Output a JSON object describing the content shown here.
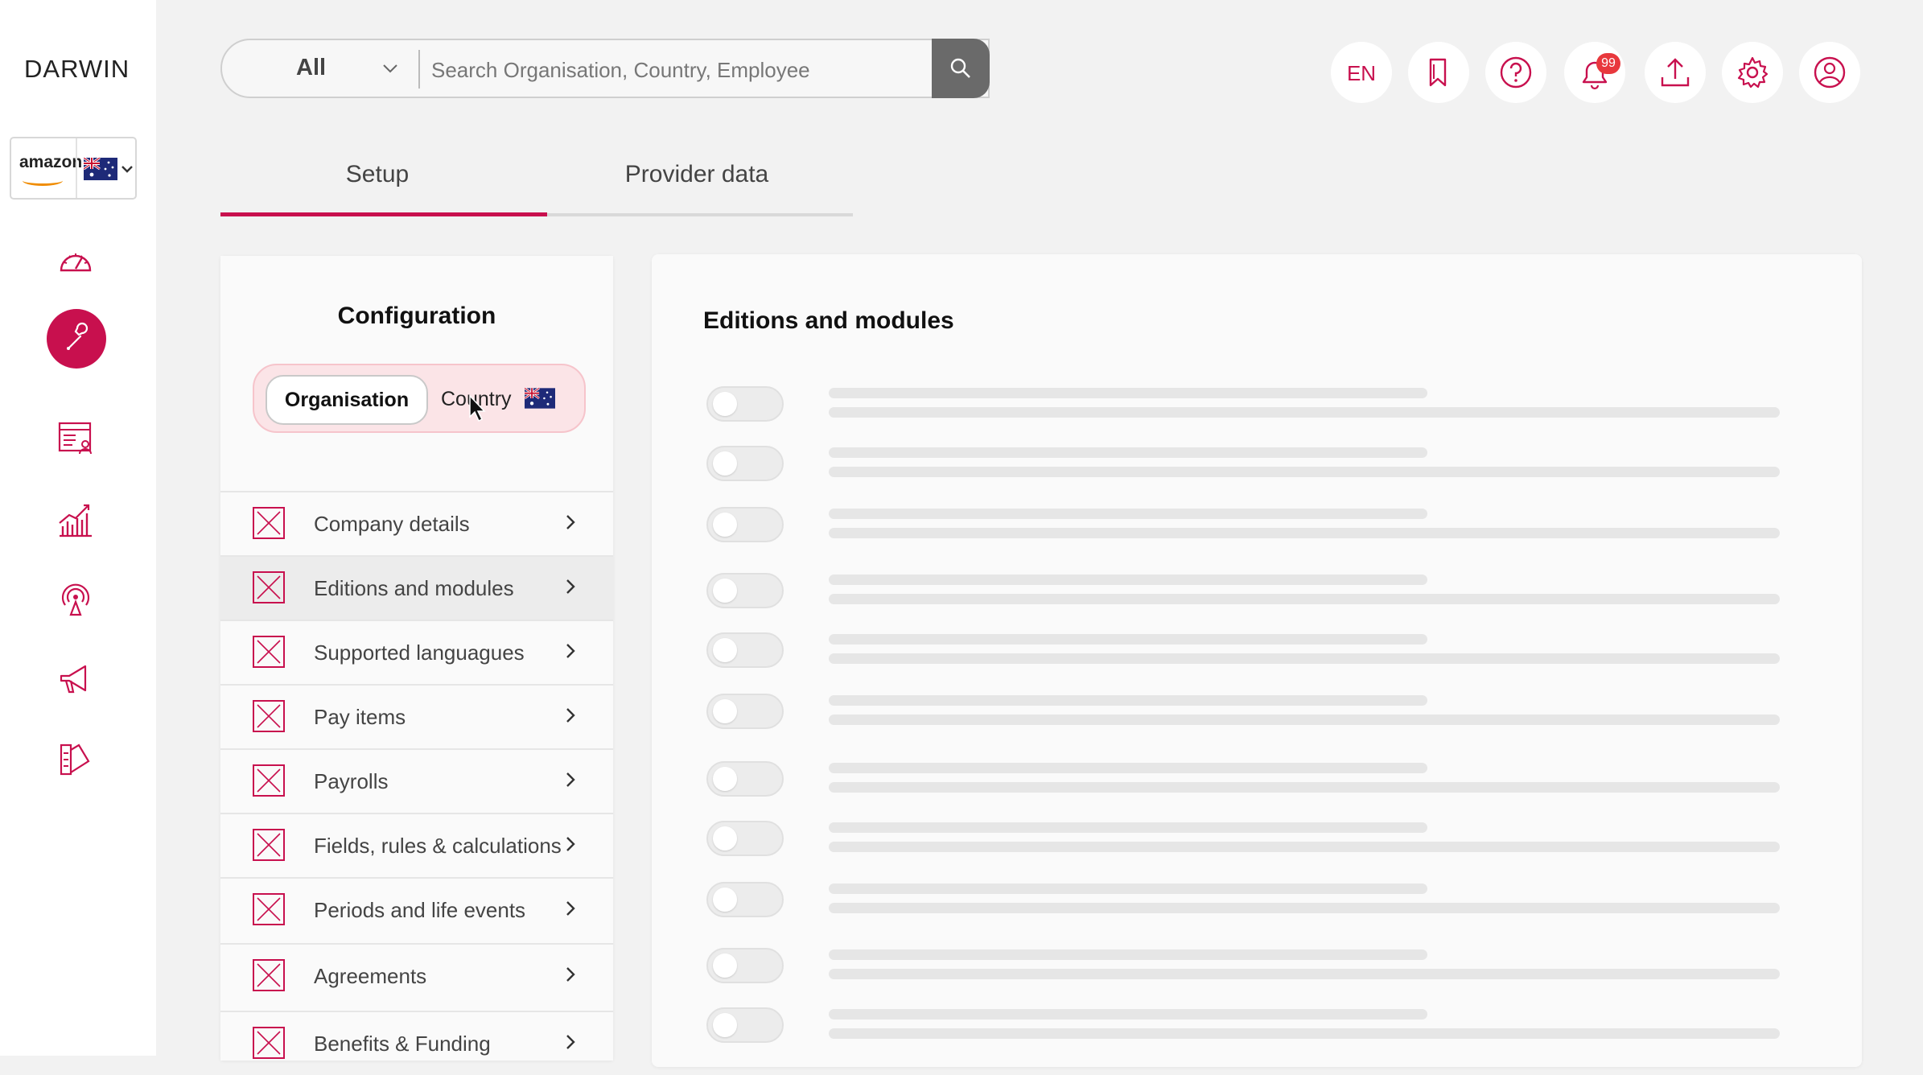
{
  "app": {
    "logo_text": "DARWIN"
  },
  "client_selector": {
    "client_logo": "amazon",
    "country_flag": "australia-flag-icon"
  },
  "rail": {
    "items": [
      {
        "name": "dashboard",
        "icon": "speedometer-icon"
      },
      {
        "name": "setup",
        "icon": "wrench-icon",
        "active": true
      },
      {
        "name": "employees",
        "icon": "employee-list-icon"
      },
      {
        "name": "analytics",
        "icon": "chart-icon"
      },
      {
        "name": "integrations",
        "icon": "broadcast-icon"
      },
      {
        "name": "announcements",
        "icon": "megaphone-icon"
      },
      {
        "name": "design",
        "icon": "swatches-icon"
      }
    ]
  },
  "search": {
    "scope": "All",
    "placeholder": "Search Organisation, Country, Employee",
    "value": ""
  },
  "header": {
    "language": "EN",
    "notification_count": "99",
    "icons": [
      "bookmark-icon",
      "help-icon",
      "bell-icon",
      "upload-icon",
      "gear-icon",
      "user-icon"
    ]
  },
  "tabs": [
    {
      "label": "Setup",
      "active": true
    },
    {
      "label": "Provider data",
      "active": false
    }
  ],
  "config": {
    "title": "Configuration",
    "segments": {
      "organisation": "Organisation",
      "country": "Country"
    },
    "items": [
      {
        "label": "Company details"
      },
      {
        "label": "Editions and modules",
        "active": true
      },
      {
        "label": "Supported languagues"
      },
      {
        "label": "Pay items"
      },
      {
        "label": "Payrolls"
      },
      {
        "label": "Fields, rules & calculations"
      },
      {
        "label": "Periods and life events"
      },
      {
        "label": "Agreements"
      },
      {
        "label": "Benefits & Funding"
      }
    ]
  },
  "main": {
    "title": "Editions and modules",
    "loading_rows": 11
  },
  "colors": {
    "accent": "#c8104e",
    "background": "#f2f2f2",
    "panel": "#fafafa",
    "badge": "#e8383d"
  }
}
